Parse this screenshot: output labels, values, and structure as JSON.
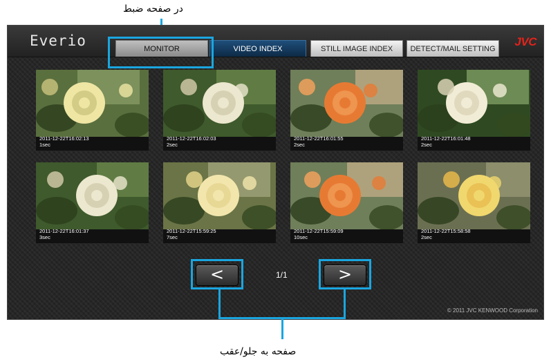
{
  "annotations": {
    "top_label": "در صفحه ضبط",
    "bottom_label": "صفحه به جلو/عقب",
    "highlight_color": "#1aa6e0"
  },
  "app": {
    "logo": "Everio",
    "brand": "JVC",
    "brand_color": "#e3231b",
    "copyright": "© 2011 JVC KENWOOD Corporation"
  },
  "tabs": [
    {
      "label": "MONITOR"
    },
    {
      "label": "VIDEO INDEX",
      "active": true
    },
    {
      "label": "STILL IMAGE INDEX"
    },
    {
      "label": "DETECT/MAIL SETTING"
    }
  ],
  "videos": [
    {
      "timestamp": "2011-12-22T16:02:13",
      "duration": "1sec",
      "thumbnail": "yellow-rose"
    },
    {
      "timestamp": "2011-12-22T16:02:03",
      "duration": "2sec",
      "thumbnail": "white-rose"
    },
    {
      "timestamp": "2011-12-22T16:01:55",
      "duration": "2sec",
      "thumbnail": "orange-flowers"
    },
    {
      "timestamp": "2011-12-22T16:01:48",
      "duration": "2sec",
      "thumbnail": "white-rose-leaves"
    },
    {
      "timestamp": "2011-12-22T16:01:37",
      "duration": "3sec",
      "thumbnail": "white-rose"
    },
    {
      "timestamp": "2011-12-22T15:59:25",
      "duration": "7sec",
      "thumbnail": "cream-roses"
    },
    {
      "timestamp": "2011-12-22T15:59:09",
      "duration": "10sec",
      "thumbnail": "orange-flowers"
    },
    {
      "timestamp": "2011-12-22T15:58:58",
      "duration": "2sec",
      "thumbnail": "yellow-roses"
    }
  ],
  "pagination": {
    "prev_icon": "chevron-left-icon",
    "next_icon": "chevron-right-icon",
    "prev_glyph": "<",
    "next_glyph": ">",
    "page_indicator": "1/1"
  }
}
